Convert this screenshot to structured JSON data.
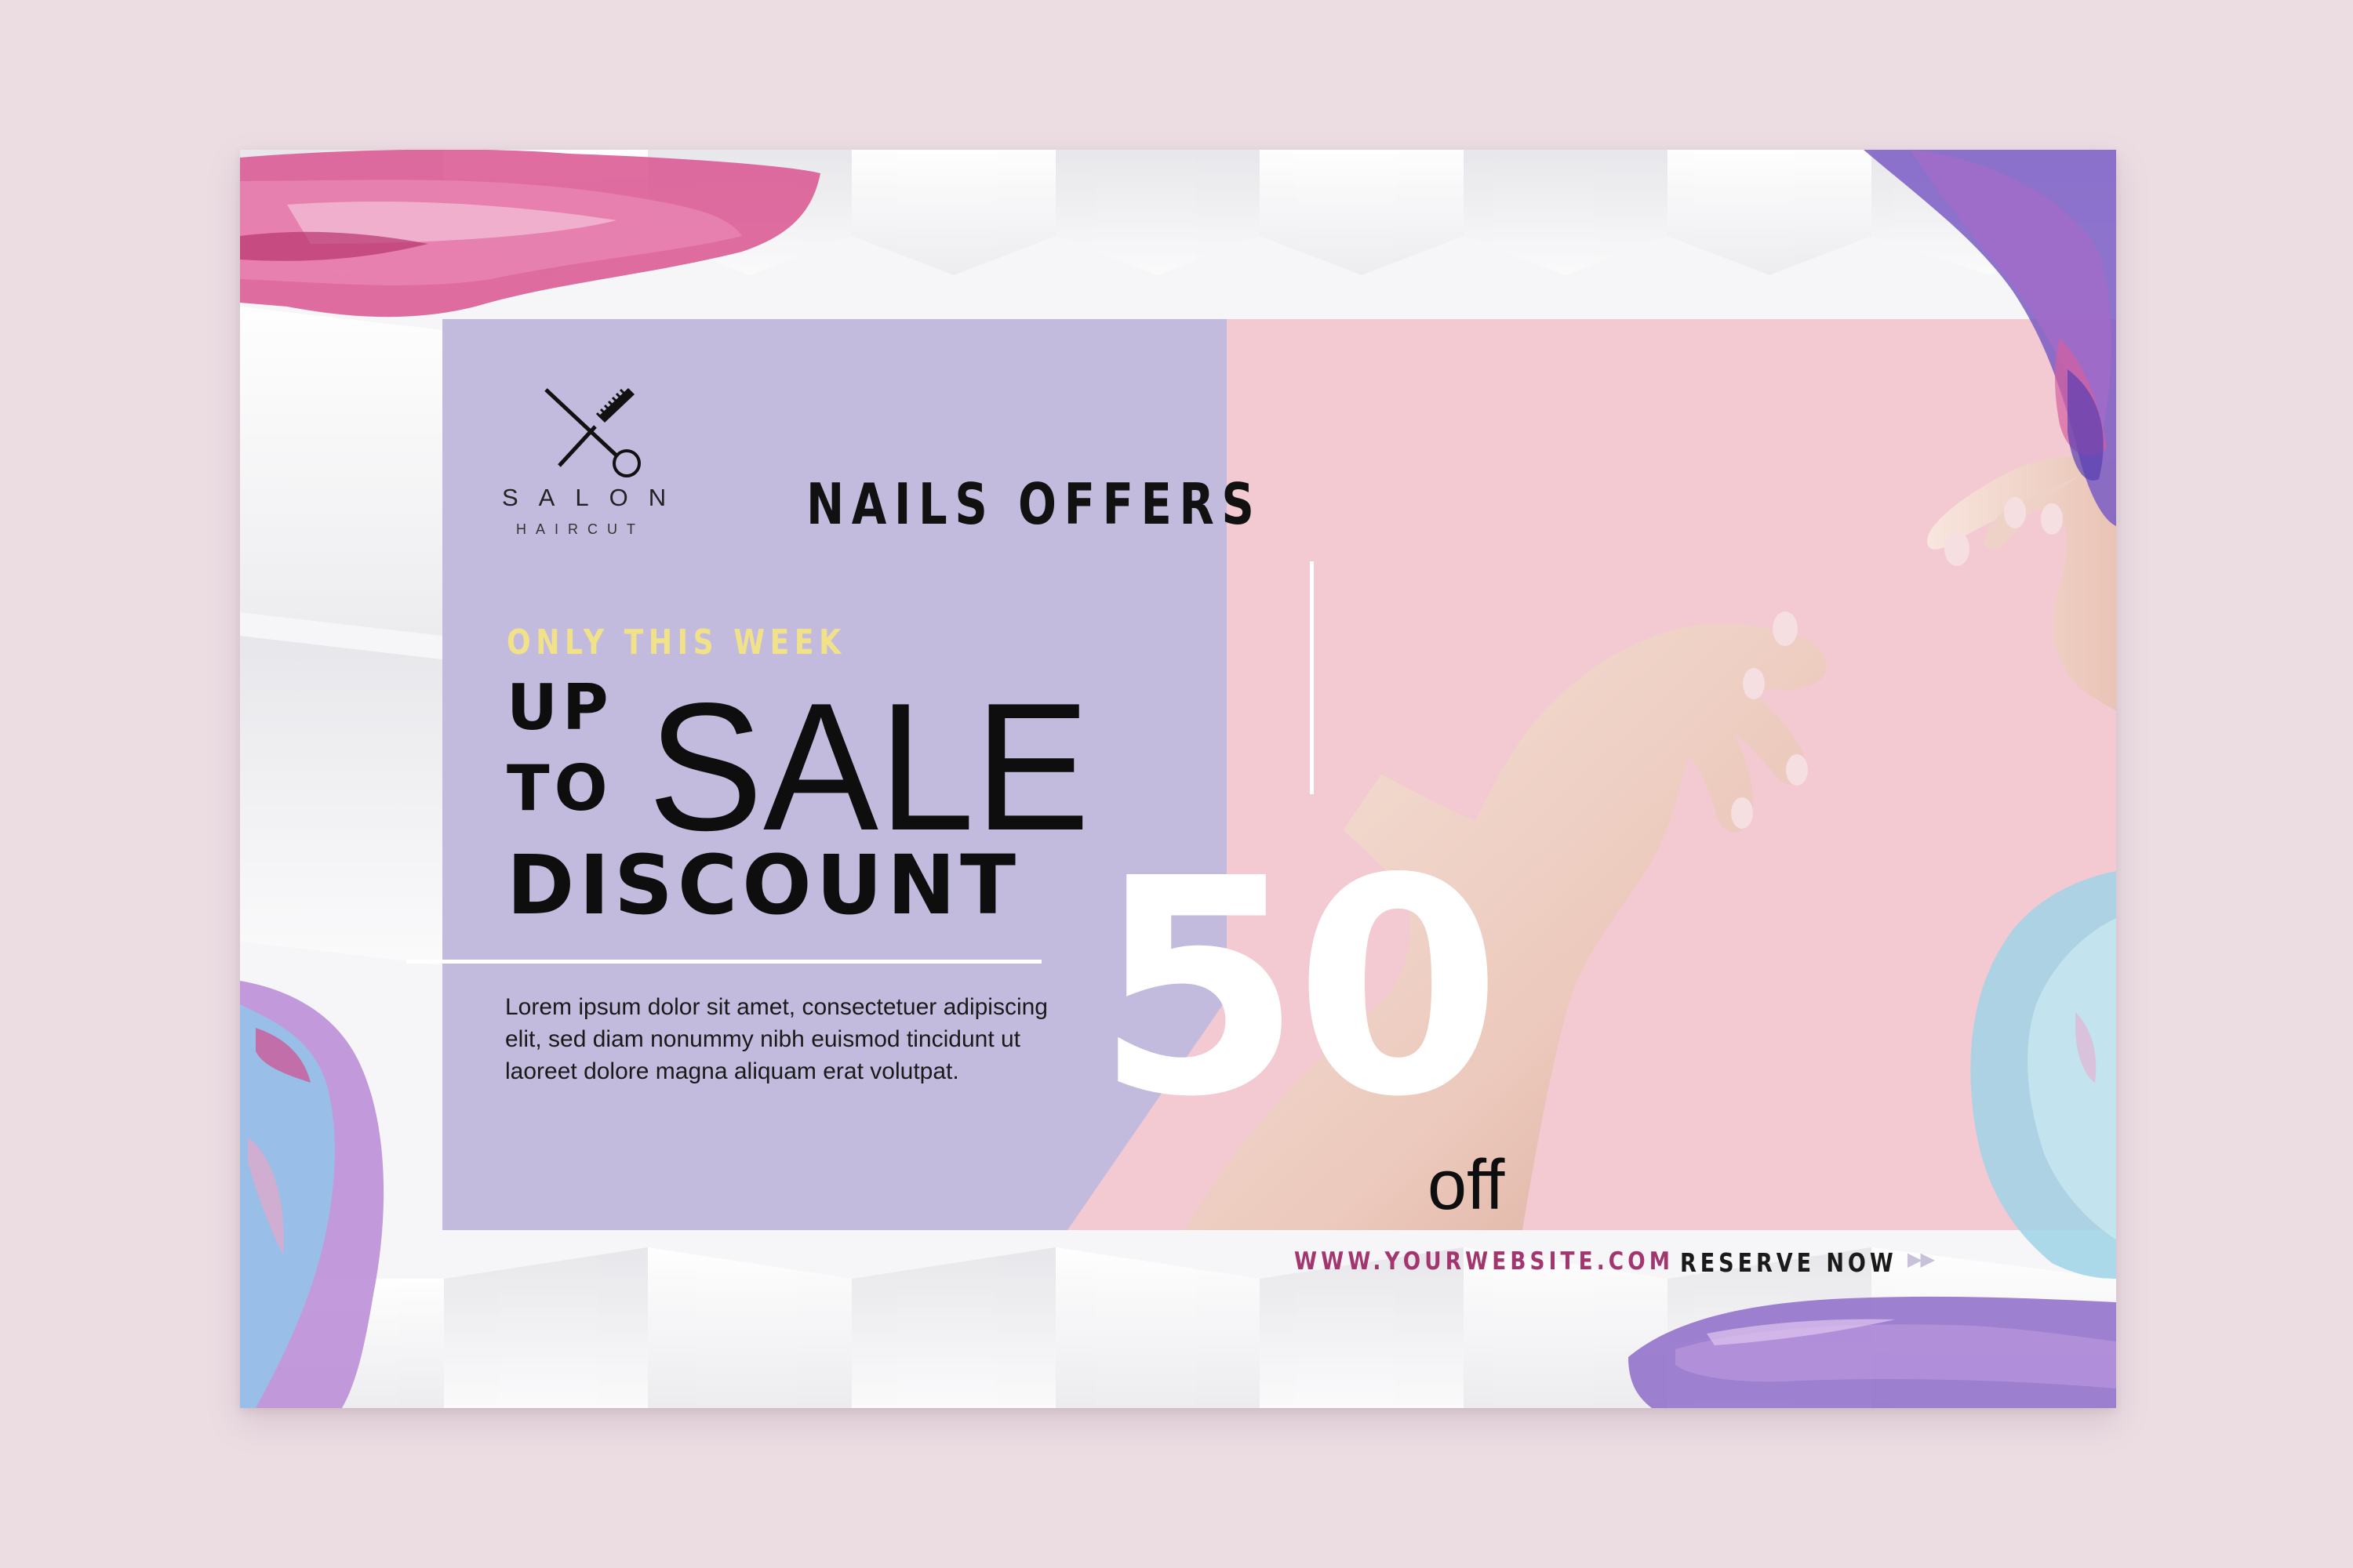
{
  "logo": {
    "salon": "SALON",
    "haircut": "HAIRCUT"
  },
  "header": {
    "title": "NAILS OFFERS"
  },
  "promo": {
    "tagline": "ONLY THIS WEEK",
    "line_up": "UP",
    "line_to": "TO",
    "line_sale": "SALE",
    "line_discount": "DISCOUNT",
    "amount": "50",
    "suffix": "off",
    "description": "Lorem ipsum dolor sit amet, consectetuer adipiscing elit, sed diam nonummy nibh euismod tincidunt ut laoreet dolore magna aliquam erat volutpat."
  },
  "footer": {
    "website": "WWW.YOURWEBSITE.COM",
    "cta": "RESERVE NOW",
    "cta_arrows": "▶▶"
  },
  "colors": {
    "page_bg": "#ecdde3",
    "panel_purple": "#c2bbde",
    "panel_pink": "#f3c9d2",
    "tagline_yellow": "#f1e28a",
    "website_magenta": "#a3366e"
  },
  "icons": [
    "scissors-comb-icon",
    "double-arrow-right-icon"
  ]
}
